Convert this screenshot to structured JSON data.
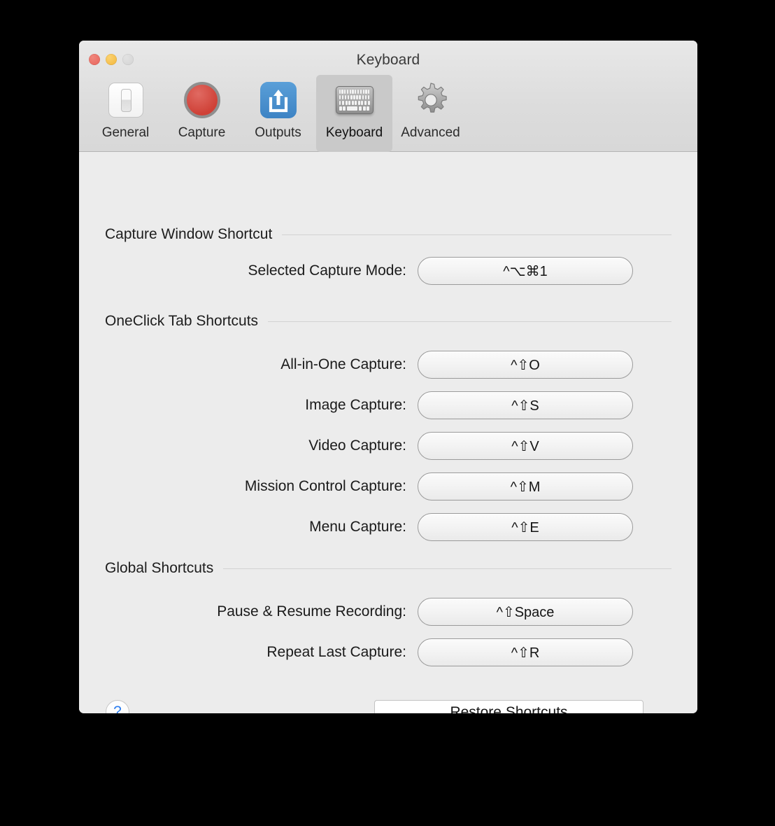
{
  "window": {
    "title": "Keyboard",
    "traffic_lights": [
      {
        "name": "close",
        "color": "#e8635a"
      },
      {
        "name": "minimize",
        "color": "#f2b53a"
      },
      {
        "name": "zoom",
        "color": "#d3d3d3"
      }
    ]
  },
  "toolbar": {
    "tabs": [
      {
        "label": "General",
        "icon": "toggle-switch-icon",
        "selected": false
      },
      {
        "label": "Capture",
        "icon": "record-button-icon",
        "selected": false
      },
      {
        "label": "Outputs",
        "icon": "share-upload-icon",
        "selected": false
      },
      {
        "label": "Keyboard",
        "icon": "keyboard-icon",
        "selected": true
      },
      {
        "label": "Advanced",
        "icon": "gear-icon",
        "selected": false
      }
    ]
  },
  "sections": [
    {
      "title": "Capture Window Shortcut",
      "rows": [
        {
          "label": "Selected Capture Mode:",
          "shortcut": "^⌥⌘1"
        }
      ]
    },
    {
      "title": "OneClick Tab Shortcuts",
      "rows": [
        {
          "label": "All-in-One Capture:",
          "shortcut": "^⇧O"
        },
        {
          "label": "Image Capture:",
          "shortcut": "^⇧S"
        },
        {
          "label": "Video Capture:",
          "shortcut": "^⇧V"
        },
        {
          "label": "Mission Control Capture:",
          "shortcut": "^⇧M"
        },
        {
          "label": "Menu Capture:",
          "shortcut": "^⇧E"
        }
      ]
    },
    {
      "title": "Global Shortcuts",
      "rows": [
        {
          "label": "Pause & Resume Recording:",
          "shortcut": "^⇧Space"
        },
        {
          "label": "Repeat Last Capture:",
          "shortcut": "^⇧R"
        }
      ]
    }
  ],
  "footer": {
    "help_label": "?",
    "restore_label": "Restore Shortcuts"
  },
  "colors": {
    "window_background": "#ececec",
    "toolbar_background": "#dcdcdc",
    "selected_tab_background": "#c9c9c9",
    "divider": "#d2d2d2",
    "help_accent": "#2a7cf0",
    "outputs_icon": "#3d83c4",
    "capture_icon": "#cf4137"
  }
}
